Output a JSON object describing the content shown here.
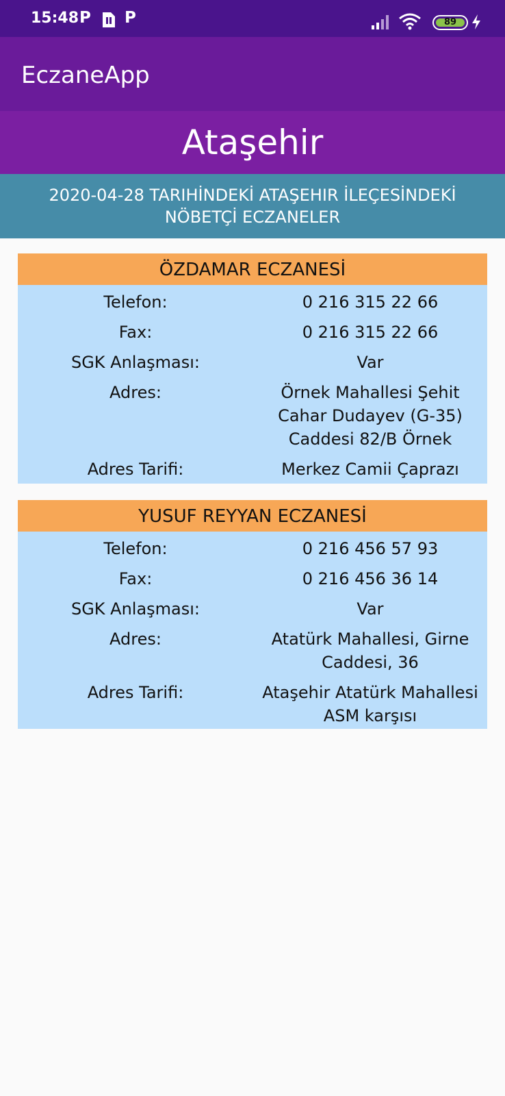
{
  "status": {
    "time": "15:48",
    "indicators": [
      "P",
      "P"
    ],
    "battery": "89"
  },
  "app": {
    "title": "EczaneApp"
  },
  "district": "Ataşehir",
  "subtitle_lines": [
    "2020-04-28 TARIHİNDEKİ ATAŞEHIR İLEÇESİNDEKİ",
    "NÖBETÇİ ECZANELER"
  ],
  "pharmacies": [
    {
      "name": "ÖZDAMAR ECZANESİ",
      "phone_label": "Telefon:",
      "phone": "0 216 315 22 66",
      "fax_label": "Fax:",
      "fax": "0 216 315 22 66",
      "sgk_label": "SGK Anlaşması:",
      "sgk": "Var",
      "address_label": "Adres:",
      "address_lines": [
        "Örnek Mahallesi Şehit",
        "Cahar Dudayev (G-35)",
        "Caddesi 82/B Örnek"
      ],
      "directions_label": "Adres Tarifi:",
      "directions_lines": [
        "Merkez Camii Çaprazı"
      ]
    },
    {
      "name": "YUSUF REYYAN ECZANESİ",
      "phone_label": "Telefon:",
      "phone": "0 216 456 57 93",
      "fax_label": "Fax:",
      "fax": "0 216 456 36 14",
      "sgk_label": "SGK Anlaşması:",
      "sgk": "Var",
      "address_label": "Adres:",
      "address_lines": [
        "Atatürk Mahallesi, Girne",
        "Caddesi, 36"
      ],
      "directions_label": "Adres Tarifi:",
      "directions_lines": [
        "Ataşehir Atatürk Mahallesi",
        "ASM karşısı"
      ]
    }
  ],
  "colors": {
    "status_bar": "#4a148c",
    "app_bar": "#6a1b9a",
    "district_bar": "#7b1fa2",
    "subtitle_bar": "#468ca8",
    "card_header": "#f7a756",
    "card_body": "#bbdefb"
  },
  "icons": [
    "parking-icon",
    "sim-card-icon",
    "signal-icon",
    "wifi-icon",
    "battery-icon",
    "charging-icon"
  ]
}
